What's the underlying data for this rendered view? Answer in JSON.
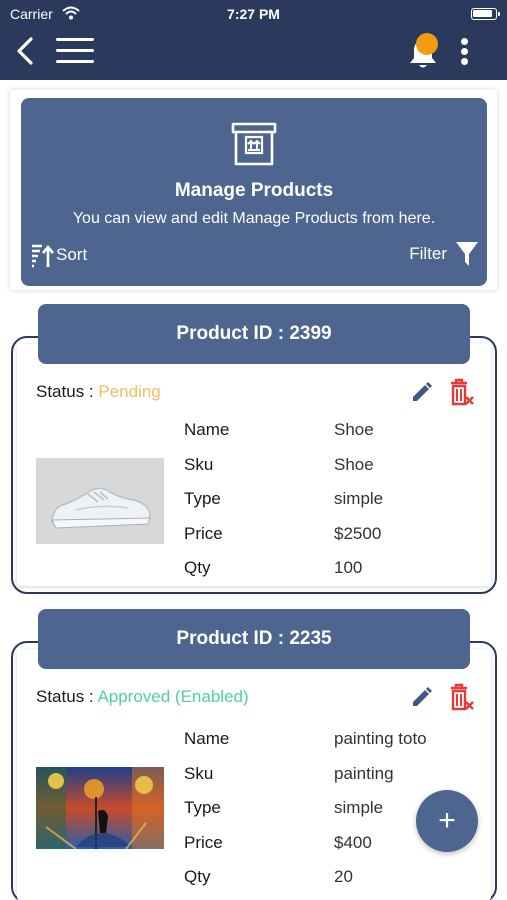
{
  "status_bar": {
    "carrier": "Carrier",
    "time": "7:27 PM"
  },
  "colors": {
    "header": "#2b3a5c",
    "accent": "#4e6590",
    "pending": "#f0c060",
    "approved": "#4fd1a5",
    "delete": "#e53935",
    "notification_dot": "#f39c12"
  },
  "header": {
    "icons": [
      "back-chevron-icon",
      "hamburger-menu-icon",
      "bell-icon",
      "more-vertical-icon"
    ]
  },
  "banner": {
    "title": "Manage Products",
    "subtitle": "You can view and edit Manage Products from here.",
    "sort_label": "Sort",
    "filter_label": "Filter",
    "icon": "box-upload-icon"
  },
  "products": [
    {
      "id_label": "Product ID : 2399",
      "status_label": "Status : ",
      "status_value": "Pending",
      "image": "sneaker-image",
      "fields": [
        {
          "label": "Name",
          "value": "Shoe"
        },
        {
          "label": "Sku",
          "value": "Shoe"
        },
        {
          "label": "Type",
          "value": "simple"
        },
        {
          "label": "Price",
          "value": "$2500"
        },
        {
          "label": "Qty",
          "value": "100"
        }
      ]
    },
    {
      "id_label": "Product ID : 2235",
      "status_label": "Status : ",
      "status_value": "Approved (Enabled)",
      "image": "painting-image",
      "fields": [
        {
          "label": "Name",
          "value": "painting toto"
        },
        {
          "label": "Sku",
          "value": "painting"
        },
        {
          "label": "Type",
          "value": "simple"
        },
        {
          "label": "Price",
          "value": "$400"
        },
        {
          "label": "Qty",
          "value": "20"
        }
      ]
    }
  ],
  "fab": {
    "label": "+"
  }
}
